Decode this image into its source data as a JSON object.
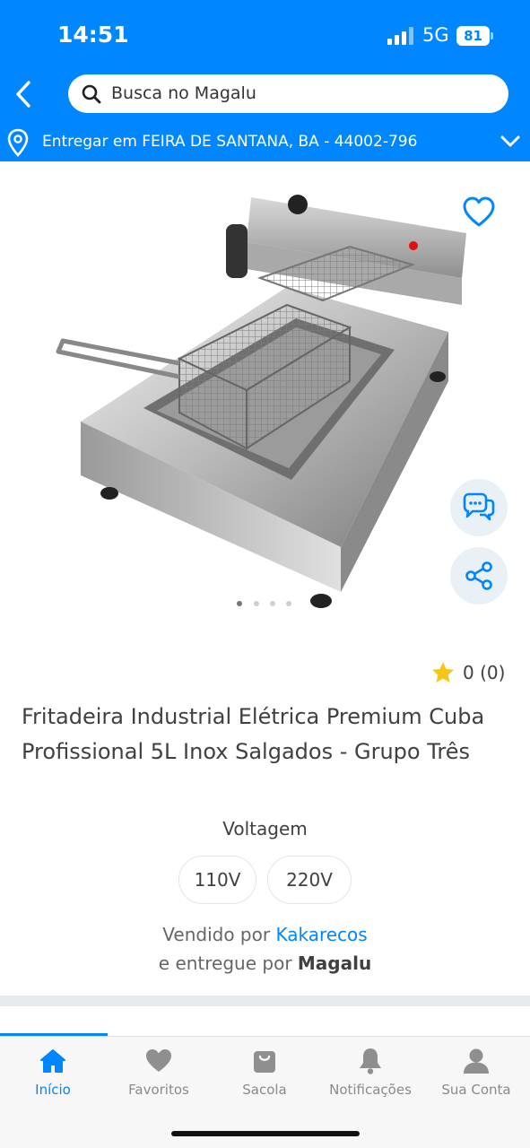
{
  "status_bar": {
    "time": "14:51",
    "network": "5G",
    "battery": "81"
  },
  "header": {
    "search_placeholder": "Busca no Magalu",
    "delivery_text": "Entregar em FEIRA DE SANTANA, BA - 44002-796"
  },
  "gallery": {
    "image_count": 4,
    "active_index": 0
  },
  "product": {
    "rating": "0 (0)",
    "title": "Fritadeira Industrial Elétrica Premium Cuba Profissional 5L Inox Salgados - Grupo Três",
    "variant_label": "Voltagem",
    "variants": [
      "110V",
      "220V"
    ],
    "sold_by_prefix": "Vendido por",
    "seller": "Kakarecos",
    "delivered_by_prefix": "e entregue por",
    "delivered_by": "Magalu"
  },
  "bottom_nav": {
    "items": [
      {
        "label": "Início",
        "icon": "home-icon",
        "active": true
      },
      {
        "label": "Favoritos",
        "icon": "heart-icon",
        "active": false
      },
      {
        "label": "Sacola",
        "icon": "bag-icon",
        "active": false
      },
      {
        "label": "Notificações",
        "icon": "bell-icon",
        "active": false
      },
      {
        "label": "Sua Conta",
        "icon": "user-icon",
        "active": false
      }
    ]
  },
  "colors": {
    "brand_blue": "#0086ff",
    "text": "#404040",
    "star": "#f5c518"
  }
}
